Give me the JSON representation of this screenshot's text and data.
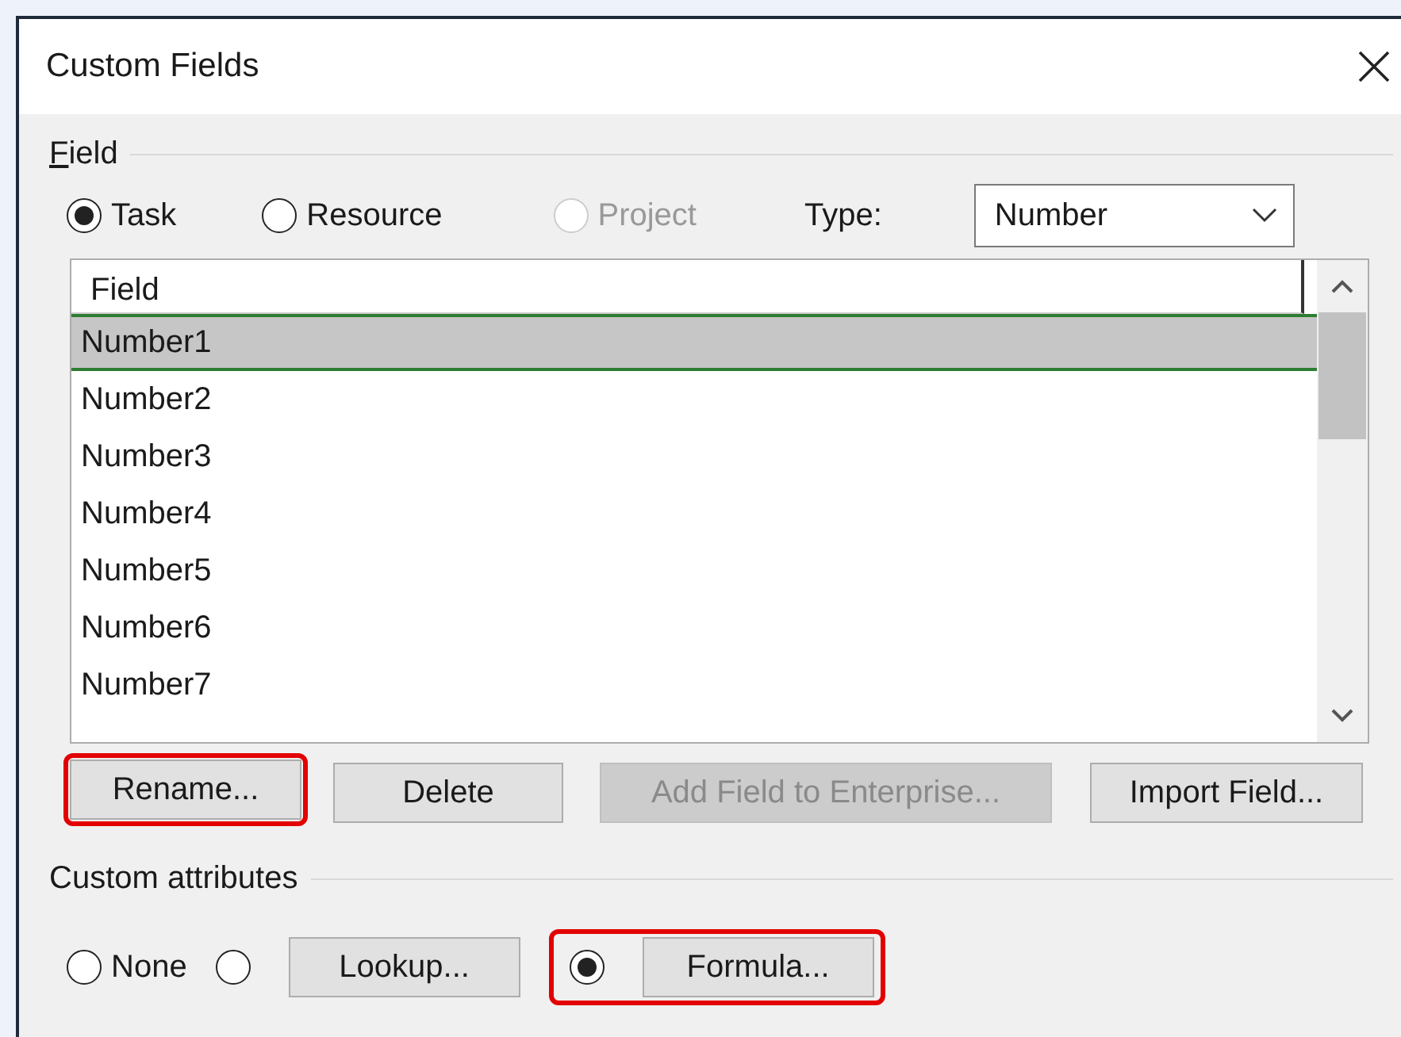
{
  "window": {
    "title": "Custom Fields"
  },
  "field_group": {
    "label": "Field"
  },
  "scope": [
    {
      "label": "Task",
      "selected": true,
      "disabled": false
    },
    {
      "label": "Resource",
      "selected": false,
      "disabled": false
    },
    {
      "label": "Project",
      "selected": false,
      "disabled": true
    }
  ],
  "type": {
    "label": "Type:",
    "value": "Number"
  },
  "list": {
    "column": "Field",
    "rows": [
      {
        "text": "Number1",
        "selected": true
      },
      {
        "text": "Number2",
        "selected": false
      },
      {
        "text": "Number3",
        "selected": false
      },
      {
        "text": "Number4",
        "selected": false
      },
      {
        "text": "Number5",
        "selected": false
      },
      {
        "text": "Number6",
        "selected": false
      },
      {
        "text": "Number7",
        "selected": false
      }
    ]
  },
  "buttons": [
    {
      "label": "Rename...",
      "disabled": false,
      "highlighted": true
    },
    {
      "label": "Delete",
      "disabled": false,
      "highlighted": false
    },
    {
      "label": "Add Field to Enterprise...",
      "disabled": true,
      "highlighted": false
    },
    {
      "label": "Import Field...",
      "disabled": false,
      "highlighted": false
    }
  ],
  "custom_attributes": {
    "label": "Custom attributes",
    "options": [
      {
        "kind": "radio",
        "label": "None",
        "selected": false,
        "highlighted": false
      },
      {
        "kind": "radio_button",
        "button": "Lookup...",
        "selected": false,
        "highlighted": false
      },
      {
        "kind": "radio_button",
        "button": "Formula...",
        "selected": true,
        "highlighted": true
      }
    ]
  }
}
